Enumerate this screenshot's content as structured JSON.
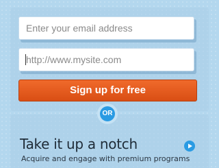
{
  "signup_form": {
    "email_placeholder": "Enter your email address",
    "website_placeholder": "http://www.mysite.com",
    "submit_label": "Sign up for free"
  },
  "divider": {
    "label": "OR"
  },
  "premium": {
    "title": "Take it up a notch",
    "subtitle": "Acquire and engage with premium programs",
    "play_icon": "play-icon"
  },
  "colors": {
    "background": "#b3d7ee",
    "cta": "#e05a1c",
    "accent_blue": "#2a9be3",
    "heading": "#1f2c38"
  }
}
